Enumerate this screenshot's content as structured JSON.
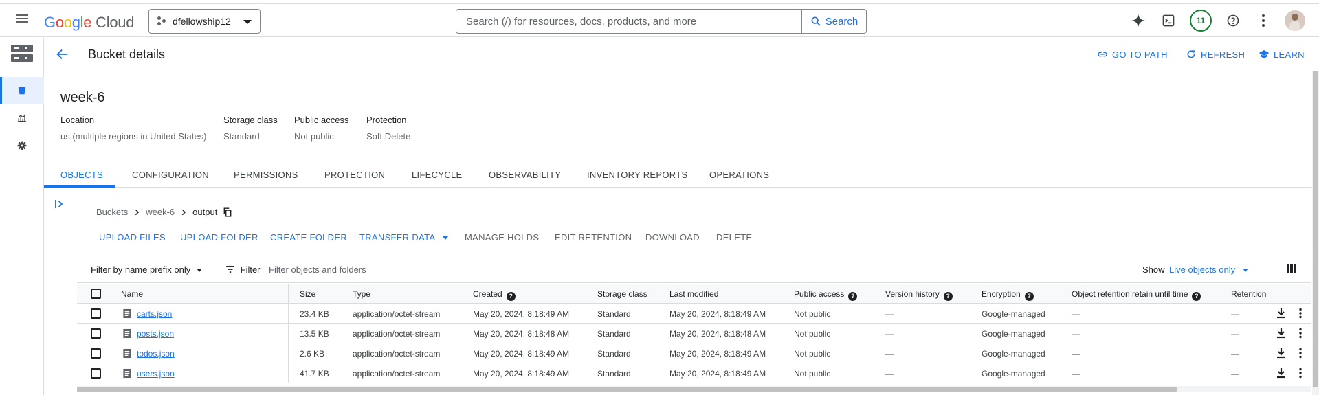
{
  "topbar": {
    "logo_google": "Google",
    "logo_cloud": "Cloud",
    "project": "dfellowship12",
    "search_placeholder": "Search (/) for resources, docs, products, and more",
    "search_button": "Search",
    "notifications_count": "11"
  },
  "header": {
    "title": "Bucket details",
    "actions": [
      "GO TO PATH",
      "REFRESH",
      "LEARN"
    ]
  },
  "bucket": {
    "name": "week-6",
    "meta": [
      {
        "label": "Location",
        "value": "us (multiple regions in United States)"
      },
      {
        "label": "Storage class",
        "value": "Standard"
      },
      {
        "label": "Public access",
        "value": "Not public"
      },
      {
        "label": "Protection",
        "value": "Soft Delete"
      }
    ]
  },
  "tabs": [
    "OBJECTS",
    "CONFIGURATION",
    "PERMISSIONS",
    "PROTECTION",
    "LIFECYCLE",
    "OBSERVABILITY",
    "INVENTORY REPORTS",
    "OPERATIONS"
  ],
  "breadcrumb": [
    "Buckets",
    "week-6",
    "output"
  ],
  "toolbar": {
    "upload_files": "UPLOAD FILES",
    "upload_folder": "UPLOAD FOLDER",
    "create_folder": "CREATE FOLDER",
    "transfer_data": "TRANSFER DATA",
    "manage_holds": "MANAGE HOLDS",
    "edit_retention": "EDIT RETENTION",
    "download": "DOWNLOAD",
    "delete": "DELETE"
  },
  "filterbar": {
    "prefix_filter": "Filter by name prefix only",
    "filter_label": "Filter",
    "filter_placeholder": "Filter objects and folders",
    "show_label": "Show",
    "show_value": "Live objects only"
  },
  "table": {
    "columns": [
      "Name",
      "Size",
      "Type",
      "Created",
      "Storage class",
      "Last modified",
      "Public access",
      "Version history",
      "Encryption",
      "Object retention retain until time",
      "Retention"
    ],
    "rows": [
      {
        "name": "carts.json",
        "size": "23.4 KB",
        "type": "application/octet-stream",
        "created": "May 20, 2024, 8:18:49 AM",
        "storage_class": "Standard",
        "last_modified": "May 20, 2024, 8:18:49 AM",
        "public_access": "Not public",
        "version_history": "—",
        "encryption": "Google-managed",
        "retain_until": "—",
        "retention": "—"
      },
      {
        "name": "posts.json",
        "size": "13.5 KB",
        "type": "application/octet-stream",
        "created": "May 20, 2024, 8:18:48 AM",
        "storage_class": "Standard",
        "last_modified": "May 20, 2024, 8:18:48 AM",
        "public_access": "Not public",
        "version_history": "—",
        "encryption": "Google-managed",
        "retain_until": "—",
        "retention": "—"
      },
      {
        "name": "todos.json",
        "size": "2.6 KB",
        "type": "application/octet-stream",
        "created": "May 20, 2024, 8:18:49 AM",
        "storage_class": "Standard",
        "last_modified": "May 20, 2024, 8:18:49 AM",
        "public_access": "Not public",
        "version_history": "—",
        "encryption": "Google-managed",
        "retain_until": "—",
        "retention": "—"
      },
      {
        "name": "users.json",
        "size": "41.7 KB",
        "type": "application/octet-stream",
        "created": "May 20, 2024, 8:18:49 AM",
        "storage_class": "Standard",
        "last_modified": "May 20, 2024, 8:18:49 AM",
        "public_access": "Not public",
        "version_history": "—",
        "encryption": "Google-managed",
        "retain_until": "—",
        "retention": "—"
      }
    ]
  },
  "colors": {
    "accent": "#1a73e8",
    "text": "#202124",
    "muted": "#5f6368",
    "border": "#dadce0",
    "badge_green": "#188038"
  }
}
